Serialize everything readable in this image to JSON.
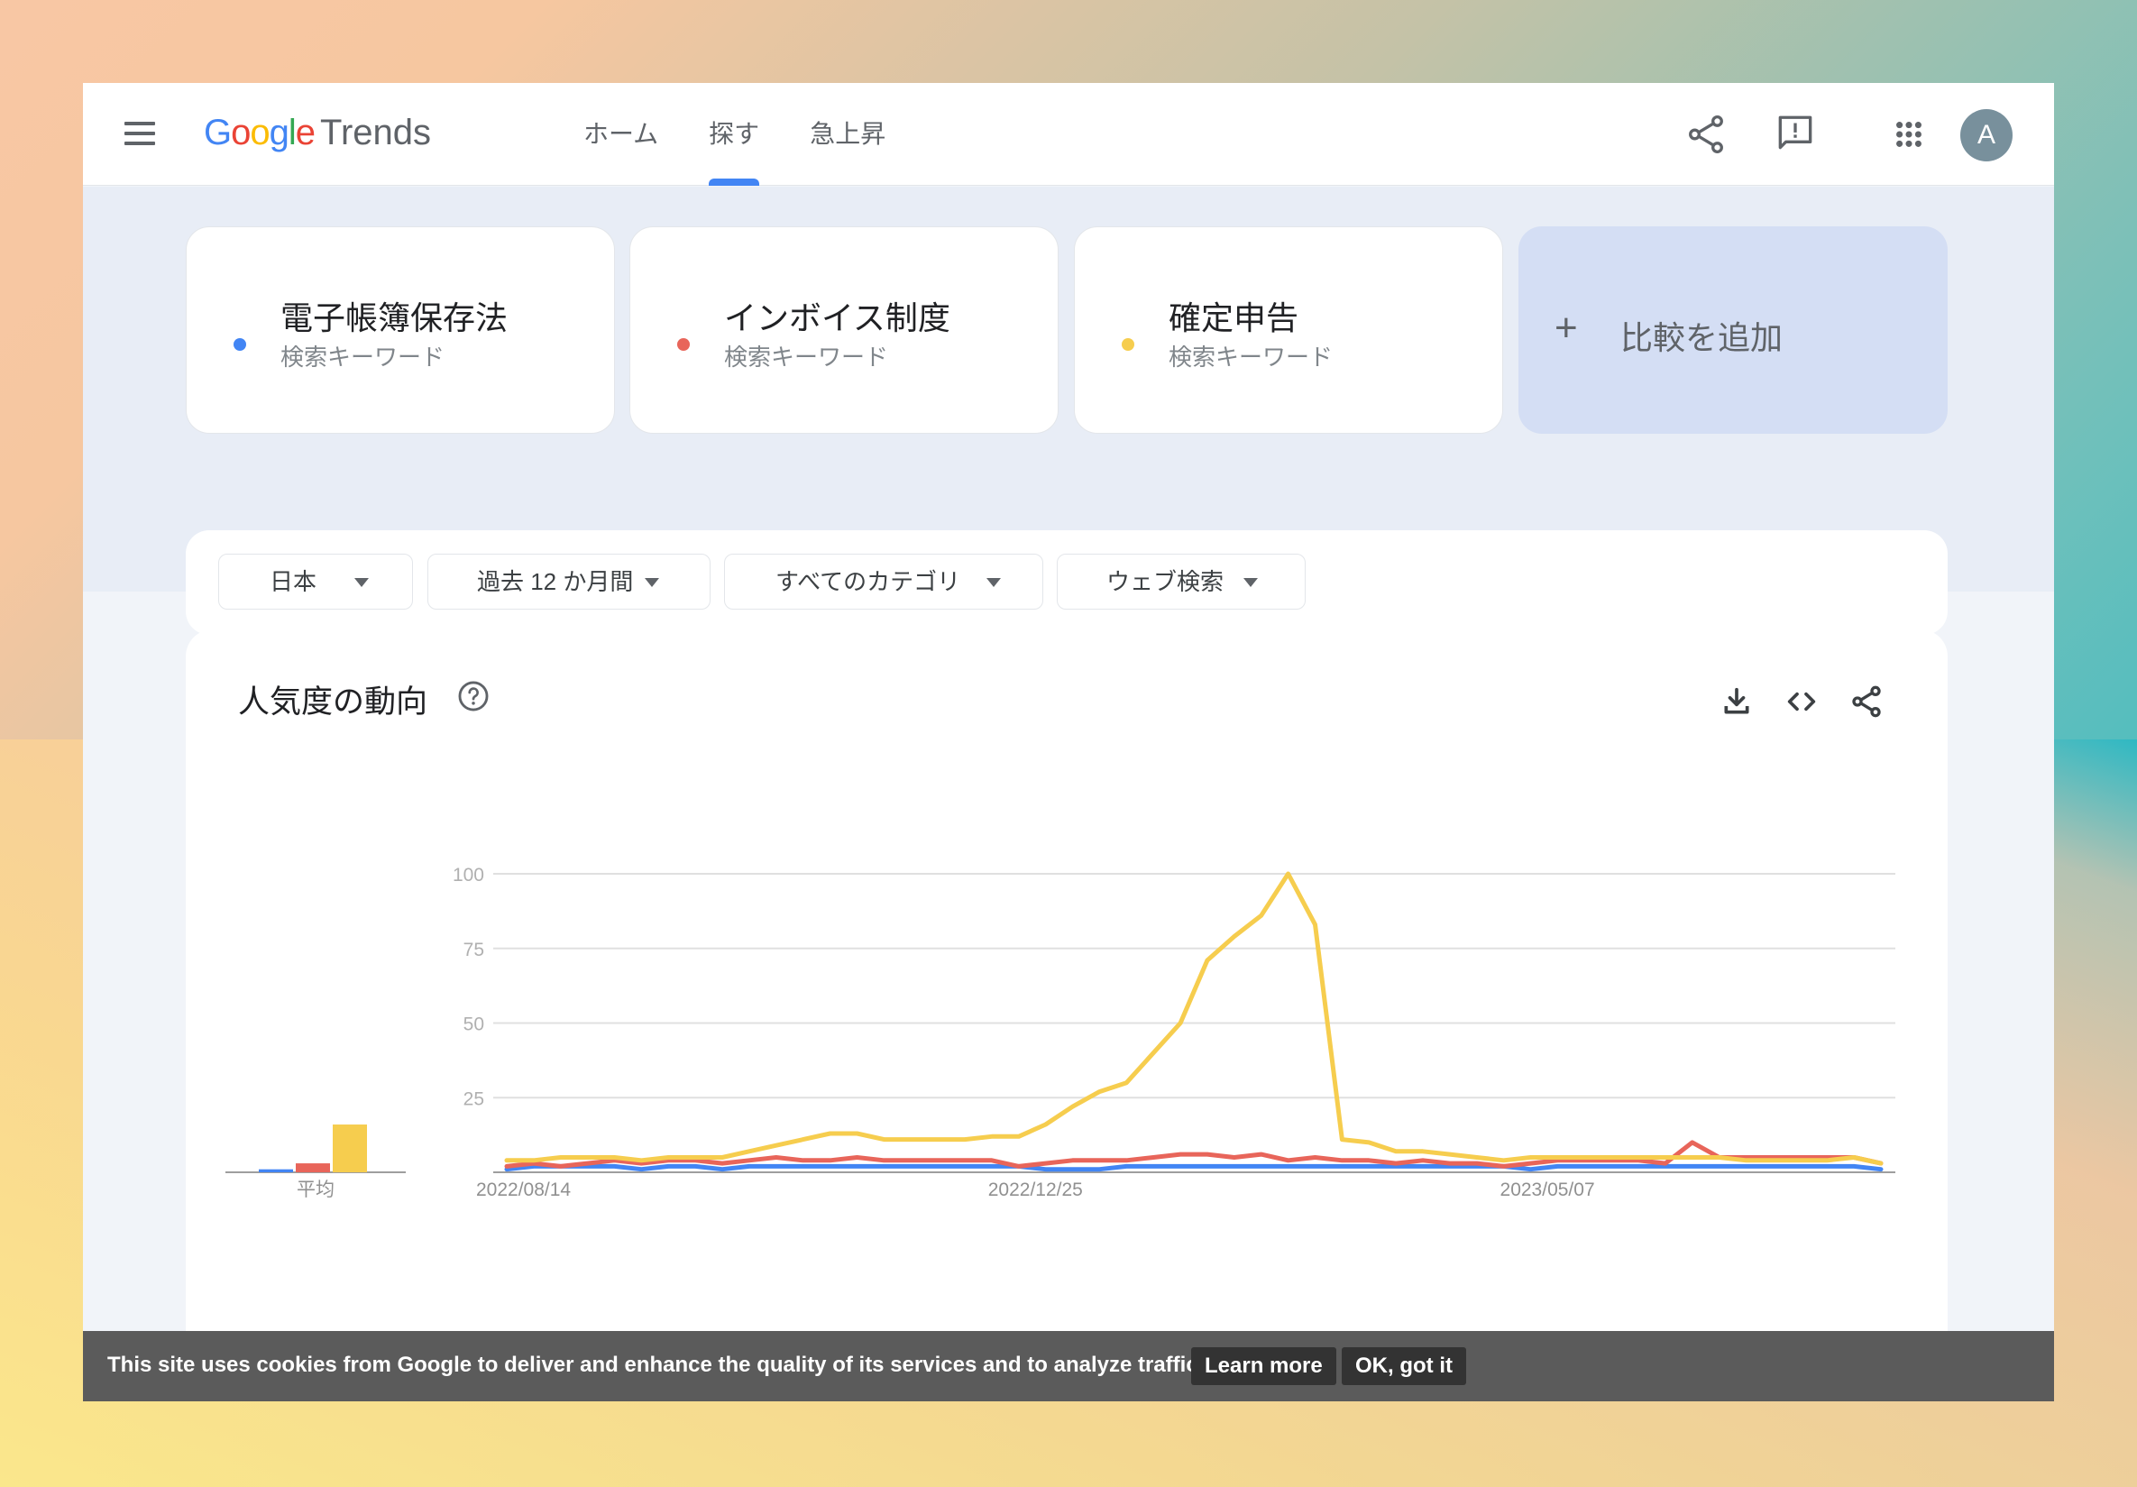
{
  "header": {
    "logo_google": [
      "G",
      "o",
      "o",
      "g",
      "l",
      "e"
    ],
    "logo_trends": "Trends",
    "nav": [
      {
        "label": "ホーム",
        "active": false
      },
      {
        "label": "探す",
        "active": true
      },
      {
        "label": "急上昇",
        "active": false
      }
    ],
    "avatar_letter": "A",
    "icons": [
      "share-icon",
      "feedback-icon",
      "apps-icon"
    ]
  },
  "terms": [
    {
      "name": "電子帳簿保存法",
      "type": "検索キーワード",
      "color": "#4285f4"
    },
    {
      "name": "インボイス制度",
      "type": "検索キーワード",
      "color": "#e8655a"
    },
    {
      "name": "確定申告",
      "type": "検索キーワード",
      "color": "#f6cd4e"
    }
  ],
  "add_compare": {
    "icon": "+",
    "label": "比較を追加"
  },
  "filters": [
    {
      "label": "日本"
    },
    {
      "label": "過去 12 か月間"
    },
    {
      "label": "すべてのカテゴリ"
    },
    {
      "label": "ウェブ検索"
    }
  ],
  "chart_card": {
    "title": "人気度の動向",
    "icons": [
      "help-icon",
      "download-icon",
      "embed-icon",
      "share-icon"
    ]
  },
  "chart_data": {
    "type": "line",
    "title": "人気度の動向",
    "xlabel": "",
    "ylabel": "",
    "ylim": [
      0,
      100
    ],
    "yticks": [
      25,
      50,
      75,
      100
    ],
    "x_tick_labels": [
      {
        "index": 0,
        "label": "2022/08/14"
      },
      {
        "index": 19,
        "label": "2022/12/25"
      },
      {
        "index": 38,
        "label": "2023/05/07"
      }
    ],
    "x_start": "2022/08/14",
    "x_interval": "weekly",
    "num_points": 52,
    "grid": true,
    "averages_label": "平均",
    "averages": [
      {
        "name": "電子帳簿保存法",
        "value": 1,
        "color": "#4285f4"
      },
      {
        "name": "インボイス制度",
        "value": 3,
        "color": "#e8655a"
      },
      {
        "name": "確定申告",
        "value": 16,
        "color": "#f6cd4e"
      }
    ],
    "series": [
      {
        "name": "電子帳簿保存法",
        "color": "#4285f4",
        "values": [
          1,
          2,
          2,
          2,
          2,
          1,
          2,
          2,
          1,
          2,
          2,
          2,
          2,
          2,
          2,
          2,
          2,
          2,
          2,
          2,
          1,
          1,
          1,
          2,
          2,
          2,
          2,
          2,
          2,
          2,
          2,
          2,
          2,
          2,
          2,
          2,
          2,
          2,
          1,
          2,
          2,
          2,
          2,
          2,
          2,
          2,
          2,
          2,
          2,
          2,
          2,
          1
        ]
      },
      {
        "name": "インボイス制度",
        "color": "#e8655a",
        "values": [
          2,
          3,
          2,
          3,
          4,
          3,
          4,
          4,
          3,
          4,
          5,
          4,
          4,
          5,
          4,
          4,
          4,
          4,
          4,
          2,
          3,
          4,
          4,
          4,
          5,
          6,
          6,
          5,
          6,
          4,
          5,
          4,
          4,
          3,
          4,
          3,
          3,
          2,
          3,
          4,
          4,
          4,
          4,
          3,
          10,
          5,
          5,
          5,
          5,
          5,
          5,
          3
        ]
      },
      {
        "name": "確定申告",
        "color": "#f6cd4e",
        "values": [
          4,
          4,
          5,
          5,
          5,
          4,
          5,
          5,
          5,
          7,
          9,
          11,
          13,
          13,
          11,
          11,
          11,
          11,
          12,
          12,
          16,
          22,
          27,
          30,
          40,
          50,
          71,
          79,
          86,
          100,
          83,
          11,
          10,
          7,
          7,
          6,
          5,
          4,
          5,
          5,
          5,
          5,
          5,
          5,
          5,
          5,
          4,
          4,
          4,
          4,
          5,
          3
        ]
      }
    ]
  },
  "cookie": {
    "text": "This site uses cookies from Google to deliver and enhance the quality of its services and to analyze traffic.",
    "learn_more": "Learn more",
    "ok": "OK, got it"
  }
}
